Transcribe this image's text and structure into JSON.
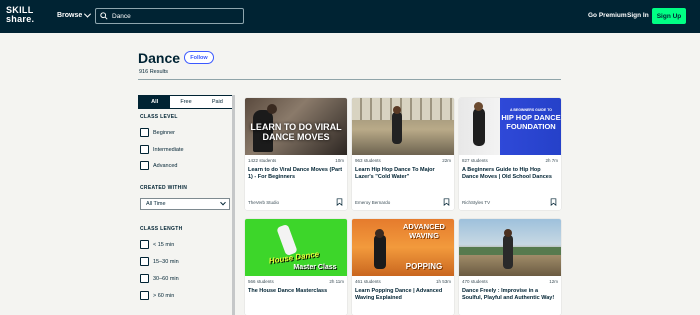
{
  "header": {
    "logo_line1": "SKILL",
    "logo_line2": "share.",
    "browse_label": "Browse",
    "search": {
      "value": "Dance",
      "placeholder": ""
    },
    "go_premium": "Go Premium",
    "sign_in": "Sign In",
    "sign_up": "Sign Up"
  },
  "page": {
    "title": "Dance",
    "follow_label": "Follow",
    "results": "916 Results"
  },
  "filters": {
    "tabs": [
      {
        "label": "All",
        "active": true
      },
      {
        "label": "Free",
        "active": false
      },
      {
        "label": "Paid",
        "active": false
      }
    ],
    "class_level": {
      "title": "CLASS LEVEL",
      "options": [
        "Beginner",
        "Intermediate",
        "Advanced"
      ]
    },
    "created_within": {
      "title": "CREATED WITHIN",
      "selected": "All Time"
    },
    "class_length": {
      "title": "CLASS LENGTH",
      "options": [
        "< 15 min",
        "15–30 min",
        "30–60 min",
        "> 60 min"
      ]
    }
  },
  "courses": [
    {
      "students": "1422 students",
      "duration": "10m",
      "title": "Learn to do Viral Dance Moves (Part 1) - For Beginners",
      "teacher": "TheVerb Studio",
      "thumb_text": "LEARN TO DO VIRAL DANCE MOVES"
    },
    {
      "students": "963 students",
      "duration": "22m",
      "title": "Learn Hip Hop Dance To Major Lazer's \"Cold Water\"",
      "teacher": "Emeroy Bernardo",
      "thumb_text": ""
    },
    {
      "students": "827 students",
      "duration": "2h 7m",
      "title": "A Beginners Guide to Hip Hop Dance Moves | Old School Dances",
      "teacher": "RichStyles TV",
      "thumb_text_small": "A BEGINNERS GUIDE TO",
      "thumb_text": "HIP HOP DANCE FOUNDATION"
    },
    {
      "students": "566 students",
      "duration": "2h 11m",
      "title": "The House Dance Masterclass",
      "teacher": "",
      "thumb_text": "House Dance",
      "thumb_text2": "Master Class"
    },
    {
      "students": "461 students",
      "duration": "1h 53m",
      "title": "Learn Popping Dance | Advanced Waving Explained",
      "teacher": "",
      "thumb_text": "ADVANCED WAVING",
      "thumb_text2": "POPPING"
    },
    {
      "students": "470 students",
      "duration": "12m",
      "title": "Dance Freely : Improvise in a Soulful, Playful and Authentic Way!",
      "teacher": "",
      "thumb_text": ""
    }
  ],
  "colors": {
    "navy": "#002333",
    "accent_green": "#00ff84",
    "follow_blue": "#3b59ff"
  }
}
